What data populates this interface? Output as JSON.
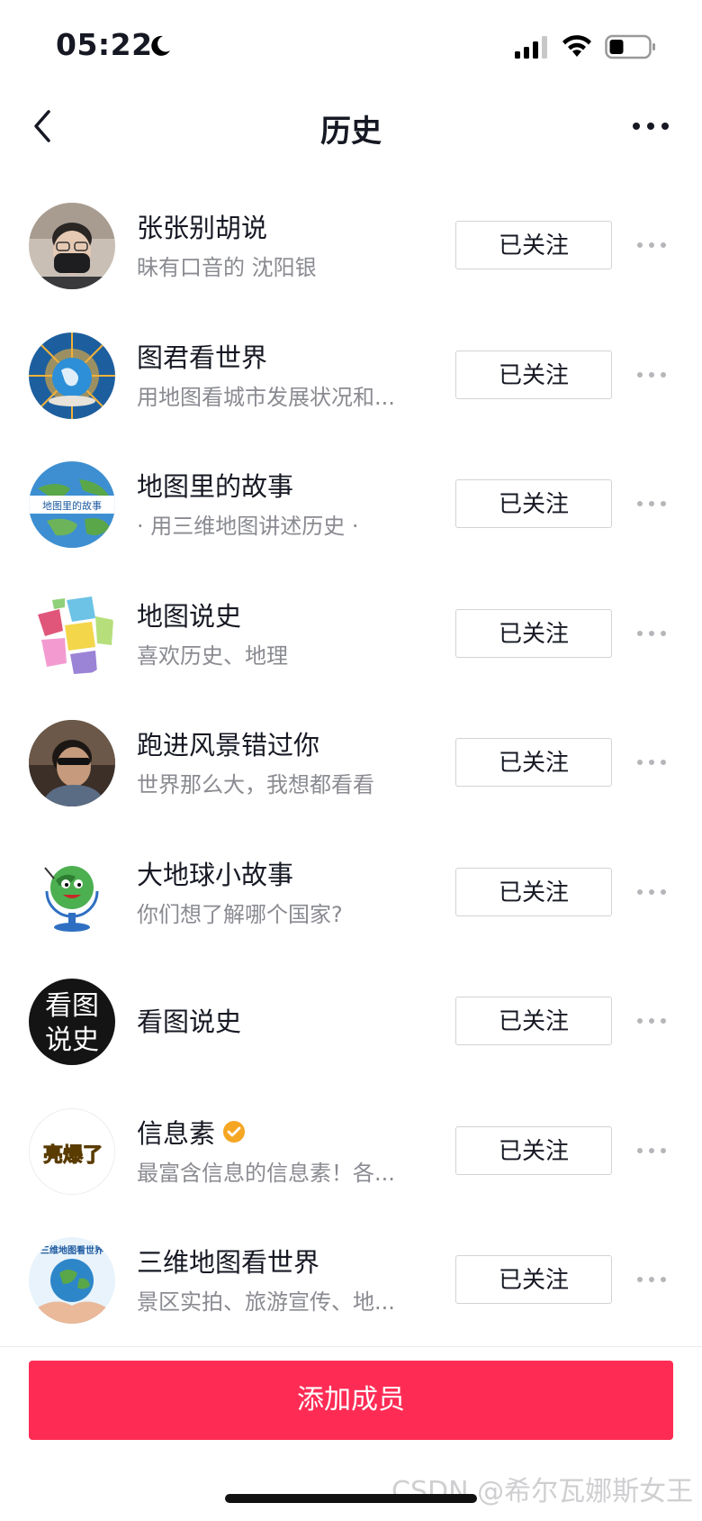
{
  "status_bar": {
    "time": "05:22"
  },
  "header": {
    "title": "历史"
  },
  "users": [
    {
      "name": "张张别胡说",
      "subtitle": "昧有口音的 沈阳银",
      "follow_label": "已关注",
      "verified": false,
      "avatar": "photo"
    },
    {
      "name": "图君看世界",
      "subtitle": "用地图看城市发展状况和...",
      "follow_label": "已关注",
      "verified": false,
      "avatar": "globe"
    },
    {
      "name": "地图里的故事",
      "subtitle": "· 用三维地图讲述历史 ·",
      "follow_label": "已关注",
      "verified": false,
      "avatar": "globe-banner",
      "avatar_text": "地图里的故事"
    },
    {
      "name": "地图说史",
      "subtitle": "喜欢历史、地理",
      "follow_label": "已关注",
      "verified": false,
      "avatar": "map"
    },
    {
      "name": "跑进风景错过你",
      "subtitle": "世界那么大，我想都看看",
      "follow_label": "已关注",
      "verified": false,
      "avatar": "photo"
    },
    {
      "name": "大地球小故事",
      "subtitle": "你们想了解哪个国家?",
      "follow_label": "已关注",
      "verified": false,
      "avatar": "cartoon-globe"
    },
    {
      "name": "看图说史",
      "subtitle": "",
      "follow_label": "已关注",
      "verified": false,
      "avatar": "text-logo",
      "avatar_text": "看图说史"
    },
    {
      "name": "信息素",
      "subtitle": "最富含信息的信息素！各...",
      "follow_label": "已关注",
      "verified": true,
      "avatar": "text-yellow",
      "avatar_text": "亮爆了"
    },
    {
      "name": "三维地图看世界",
      "subtitle": "景区实拍、旅游宣传、地...",
      "follow_label": "已关注",
      "verified": false,
      "avatar": "globe-hands",
      "avatar_text": "三维地图看世界"
    }
  ],
  "footer": {
    "add_button": "添加成员"
  },
  "watermark": "CSDN @希尔瓦娜斯女王",
  "colors": {
    "accent": "#fe2c55",
    "secondary_text": "#8a8b91",
    "verified": "#f5a623"
  }
}
